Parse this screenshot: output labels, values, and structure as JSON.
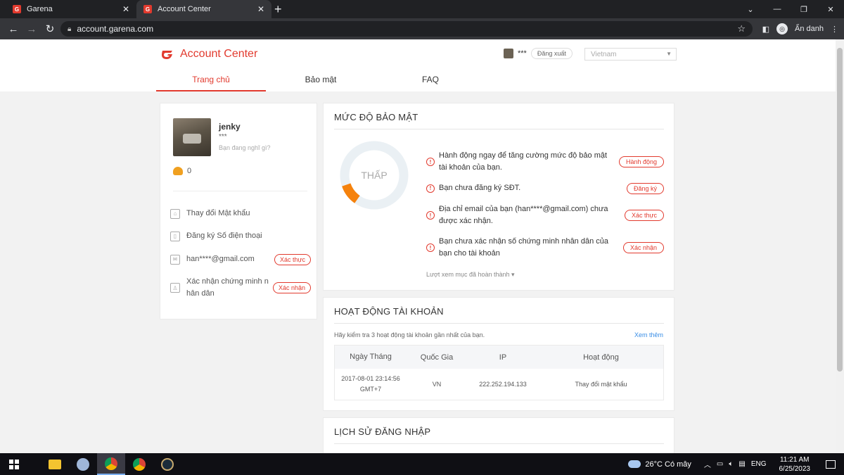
{
  "browser": {
    "tabs": [
      {
        "title": "Garena",
        "active": false
      },
      {
        "title": "Account Center",
        "active": true
      }
    ],
    "new_tab": "+",
    "url": "account.garena.com",
    "profile_label": "Ẩn danh"
  },
  "header": {
    "logo_text": "Account Center",
    "user_masked": "***",
    "logout_label": "Đăng xuất",
    "region_selected": "Vietnam"
  },
  "nav": {
    "items": [
      "Trang chủ",
      "Bảo mật",
      "FAQ"
    ],
    "active_index": 0
  },
  "profile": {
    "name": "jenky",
    "masked": "***",
    "status_placeholder": "Bạn đang nghĩ gì?",
    "shells_count": "0",
    "rows": [
      {
        "label": "Thay đổi Mật khẩu",
        "action": ""
      },
      {
        "label": "Đăng ký Số điện thoại",
        "action": ""
      },
      {
        "label": "han****@gmail.com",
        "action": "Xác thực"
      },
      {
        "label": "Xác nhận chứng minh n hân dân",
        "action": "Xác nhận"
      }
    ]
  },
  "security": {
    "title": "MỨC ĐỘ BẢO MẬT",
    "level_label": "THẤP",
    "level_fraction": 0.1,
    "accent_color": "#f5820d",
    "items": [
      {
        "text": "Hành động ngay để tăng cường mức độ bảo mật tài khoản của bạn.",
        "button": "Hành động"
      },
      {
        "text": "Bạn chưa đăng ký SĐT.",
        "button": "Đăng ký"
      },
      {
        "text": "Địa chỉ email của bạn (han****@gmail.com) chưa được xác nhận.",
        "button": "Xác thực"
      },
      {
        "text": "Bạn chưa xác nhận số chứng minh nhân dân của bạn cho tài khoản",
        "button": "Xác nhận"
      }
    ],
    "completed_toggle": "Lượt xem mục đã hoàn thành"
  },
  "activity": {
    "title": "HOẠT ĐỘNG TÀI KHOẢN",
    "hint": "Hãy kiểm tra 3 hoạt động tài khoản gần nhất của bạn.",
    "see_more": "Xem thêm",
    "columns": [
      "Ngày Tháng",
      "Quốc Gia",
      "IP",
      "Hoạt động"
    ],
    "rows": [
      {
        "date": "2017-08-01 23:14:56",
        "tz": "GMT+7",
        "country": "VN",
        "ip": "222.252.194.133",
        "action": "Thay đổi mật khẩu"
      }
    ]
  },
  "history": {
    "title": "LỊCH SỬ ĐĂNG NHẬP"
  },
  "taskbar": {
    "weather": "26°C  Có mây",
    "lang": "ENG",
    "time": "11:21 AM",
    "date": "6/25/2023"
  },
  "colors": {
    "brand": "#e23a2e",
    "link": "#3a8ee6"
  }
}
